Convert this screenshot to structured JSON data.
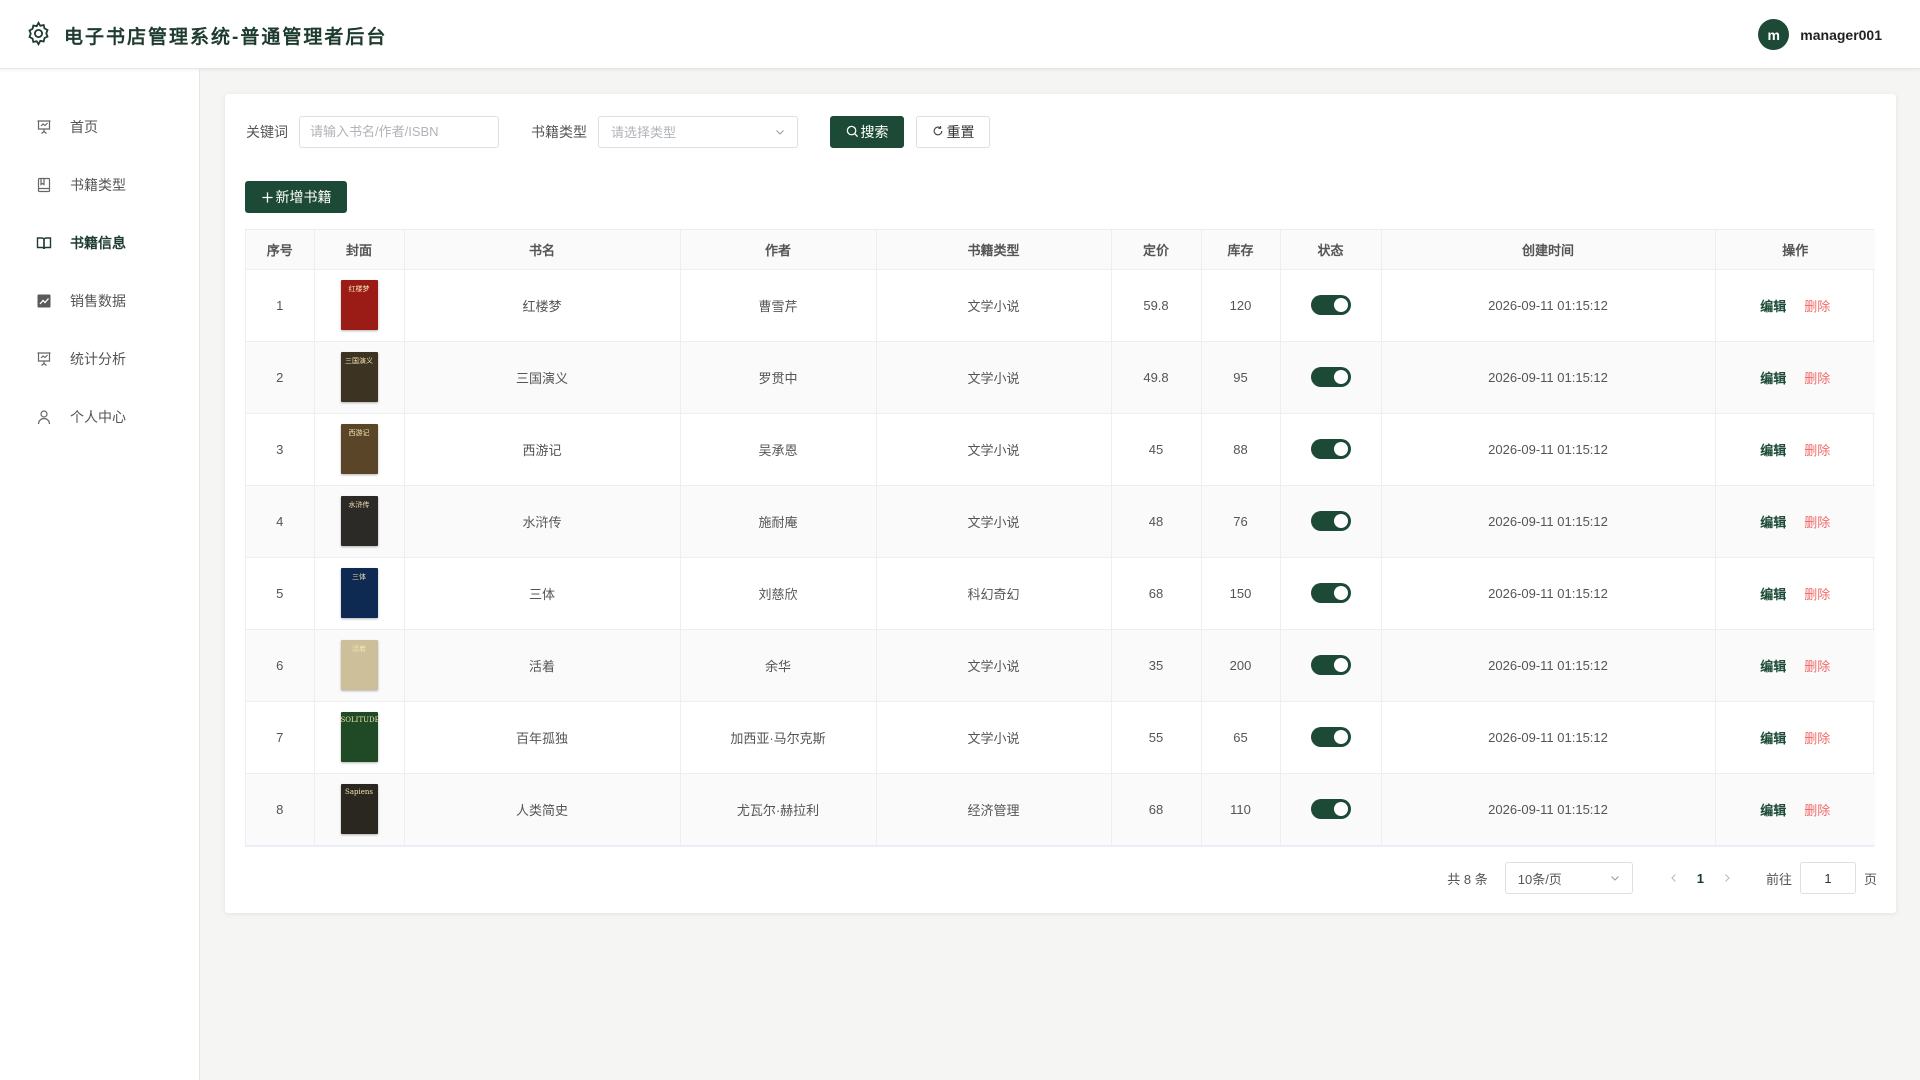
{
  "header": {
    "title": "电子书店管理系统-普通管理者后台",
    "avatar_letter": "m",
    "username": "manager001"
  },
  "sidebar": {
    "items": [
      {
        "label": "首页",
        "icon": "presentation-icon"
      },
      {
        "label": "书籍类型",
        "icon": "notebook-icon"
      },
      {
        "label": "书籍信息",
        "icon": "open-book-icon",
        "active": true
      },
      {
        "label": "销售数据",
        "icon": "trend-chart-icon"
      },
      {
        "label": "统计分析",
        "icon": "presentation-icon"
      },
      {
        "label": "个人中心",
        "icon": "user-icon"
      }
    ]
  },
  "filters": {
    "keyword_label": "关键词",
    "keyword_placeholder": "请输入书名/作者/ISBN",
    "type_label": "书籍类型",
    "type_placeholder": "请选择类型",
    "search_label": "搜索",
    "reset_label": "重置"
  },
  "add_button": "新增书籍",
  "table": {
    "columns": [
      "序号",
      "封面",
      "书名",
      "作者",
      "书籍类型",
      "定价",
      "库存",
      "状态",
      "创建时间",
      "操作"
    ],
    "edit_label": "编辑",
    "delete_label": "删除",
    "rows": [
      {
        "no": "1",
        "title": "红楼梦",
        "author": "曹雪芹",
        "type": "文学小说",
        "price": "59.8",
        "stock": "120",
        "created": "2026-09-11 01:15:12",
        "status_on": true,
        "cover_color": "#9b1c16",
        "cover_text": "红楼梦"
      },
      {
        "no": "2",
        "title": "三国演义",
        "author": "罗贯中",
        "type": "文学小说",
        "price": "49.8",
        "stock": "95",
        "created": "2026-09-11 01:15:12",
        "status_on": true,
        "cover_color": "#3d3322",
        "cover_text": "三国演义"
      },
      {
        "no": "3",
        "title": "西游记",
        "author": "吴承恩",
        "type": "文学小说",
        "price": "45",
        "stock": "88",
        "created": "2026-09-11 01:15:12",
        "status_on": true,
        "cover_color": "#5a4528",
        "cover_text": "西游记"
      },
      {
        "no": "4",
        "title": "水浒传",
        "author": "施耐庵",
        "type": "文学小说",
        "price": "48",
        "stock": "76",
        "created": "2026-09-11 01:15:12",
        "status_on": true,
        "cover_color": "#2c2a26",
        "cover_text": "水浒传"
      },
      {
        "no": "5",
        "title": "三体",
        "author": "刘慈欣",
        "type": "科幻奇幻",
        "price": "68",
        "stock": "150",
        "created": "2026-09-11 01:15:12",
        "status_on": true,
        "cover_color": "#0f2a52",
        "cover_text": "三体"
      },
      {
        "no": "6",
        "title": "活着",
        "author": "余华",
        "type": "文学小说",
        "price": "35",
        "stock": "200",
        "created": "2026-09-11 01:15:12",
        "status_on": true,
        "cover_color": "#cdbf9a",
        "cover_text": "活着"
      },
      {
        "no": "7",
        "title": "百年孤独",
        "author": "加西亚·马尔克斯",
        "type": "文学小说",
        "price": "55",
        "stock": "65",
        "created": "2026-09-11 01:15:12",
        "status_on": true,
        "cover_color": "#1f4a25",
        "cover_text": "SOLITUDE"
      },
      {
        "no": "8",
        "title": "人类简史",
        "author": "尤瓦尔·赫拉利",
        "type": "经济管理",
        "price": "68",
        "stock": "110",
        "created": "2026-09-11 01:15:12",
        "status_on": true,
        "cover_color": "#2a2620",
        "cover_text": "Sapiens"
      }
    ]
  },
  "pagination": {
    "total_text": "共 8 条",
    "page_size": "10条/页",
    "current_page": "1",
    "goto_label": "前往",
    "goto_value": "1",
    "page_suffix": "页"
  },
  "colors": {
    "primary": "#1d4a36",
    "danger": "#f06a6a",
    "background": "#f5f5f3"
  }
}
